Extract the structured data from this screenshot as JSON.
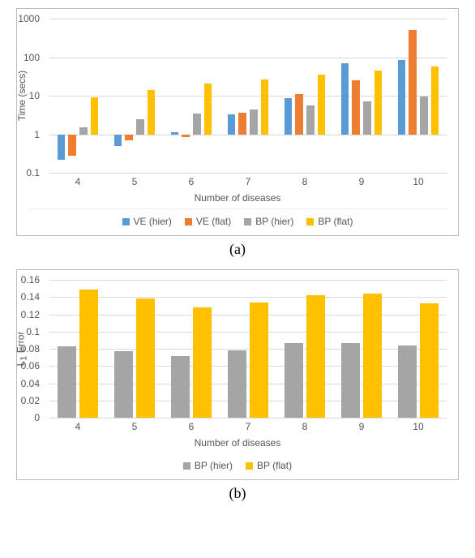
{
  "captions": {
    "a": "(a)",
    "b": "(b)"
  },
  "chart_data": [
    {
      "id": "a",
      "type": "bar",
      "title": "",
      "xlabel": "Number of diseases",
      "ylabel": "Time (secs)",
      "yscale": "log",
      "ylim": [
        0.1,
        1000
      ],
      "yticks": [
        0.1,
        1,
        10,
        100,
        1000
      ],
      "categories": [
        "4",
        "5",
        "6",
        "7",
        "8",
        "9",
        "10"
      ],
      "series": [
        {
          "name": "VE (hier)",
          "color": "#5b9bd5",
          "values": [
            0.22,
            0.5,
            1.15,
            3.3,
            8.5,
            70,
            85
          ]
        },
        {
          "name": "VE (flat)",
          "color": "#ed7d31",
          "values": [
            0.28,
            0.7,
            0.85,
            3.6,
            11,
            25,
            500
          ]
        },
        {
          "name": "BP (hier)",
          "color": "#a5a5a5",
          "values": [
            1.5,
            2.4,
            3.5,
            4.3,
            5.5,
            7,
            9.5
          ]
        },
        {
          "name": "BP (flat)",
          "color": "#ffc000",
          "values": [
            9.3,
            14,
            21,
            27,
            35,
            45,
            56
          ]
        }
      ],
      "legend_position": "bottom"
    },
    {
      "id": "b",
      "type": "bar",
      "title": "",
      "xlabel": "Number of diseases",
      "ylabel": "L1 Error",
      "ylabel_sub": "1",
      "yscale": "linear",
      "ylim": [
        0,
        0.16
      ],
      "yticks": [
        0,
        0.02,
        0.04,
        0.06,
        0.08,
        0.1,
        0.12,
        0.14,
        0.16
      ],
      "categories": [
        "4",
        "5",
        "6",
        "7",
        "8",
        "9",
        "10"
      ],
      "series": [
        {
          "name": "BP (hier)",
          "color": "#a5a5a5",
          "values": [
            0.083,
            0.077,
            0.072,
            0.078,
            0.087,
            0.087,
            0.084
          ]
        },
        {
          "name": "BP (flat)",
          "color": "#ffc000",
          "values": [
            0.149,
            0.138,
            0.128,
            0.134,
            0.142,
            0.144,
            0.133
          ]
        }
      ],
      "legend_position": "bottom"
    }
  ]
}
